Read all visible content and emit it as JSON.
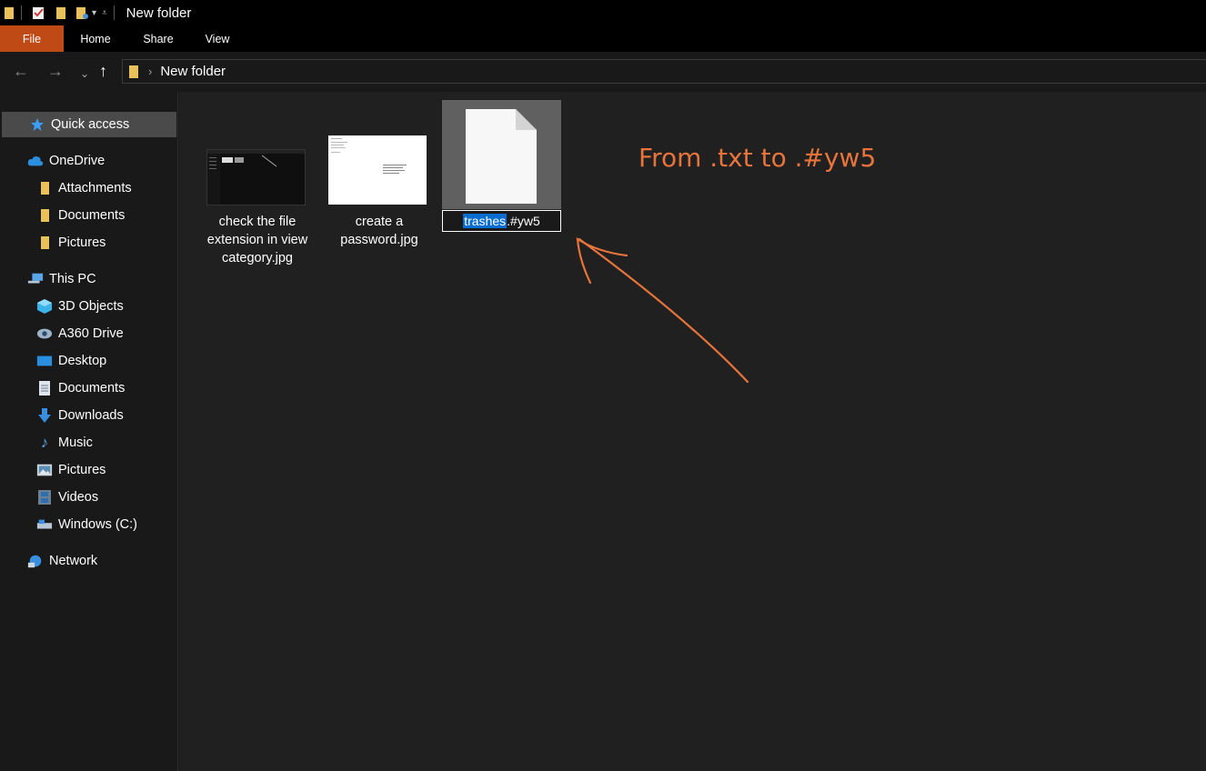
{
  "window": {
    "title": "New folder"
  },
  "ribbon": {
    "tabs": [
      "File",
      "Home",
      "Share",
      "View"
    ]
  },
  "address": {
    "path_segment": "New folder"
  },
  "sidebar": {
    "quick_access": "Quick access",
    "onedrive": "OneDrive",
    "onedrive_items": [
      "Attachments",
      "Documents",
      "Pictures"
    ],
    "this_pc": "This PC",
    "pc_items": [
      "3D Objects",
      "A360 Drive",
      "Desktop",
      "Documents",
      "Downloads",
      "Music",
      "Pictures",
      "Videos",
      "Windows (C:)"
    ],
    "network": "Network"
  },
  "files": [
    {
      "name_lines": [
        "check the file",
        "extension in view",
        "category.jpg"
      ]
    },
    {
      "name_lines": [
        "create a",
        "password.jpg"
      ]
    }
  ],
  "rename": {
    "selected_part": "trashes",
    "rest": ".#yw5"
  },
  "annotation": {
    "text": "From .txt to .#yw5",
    "color": "#e8743b"
  },
  "colors": {
    "file_tab": "#c04a16",
    "selection": "#0a6ed1",
    "folder": "#e8c15a"
  }
}
